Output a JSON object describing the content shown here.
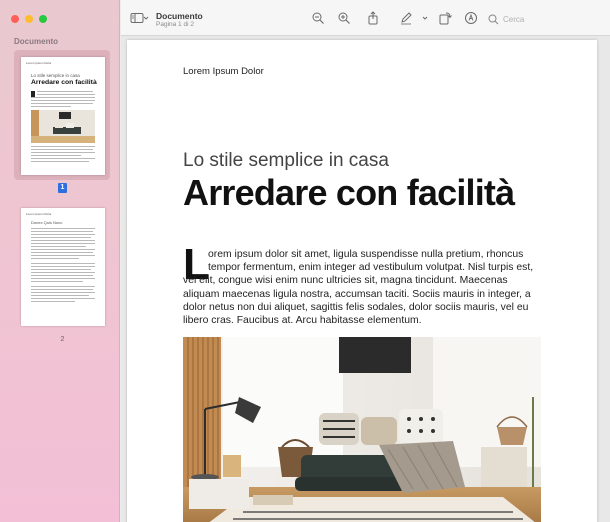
{
  "window": {
    "title": "Documento",
    "subtitle": "Pagina 1 di 2"
  },
  "sidebar": {
    "title": "Documento",
    "pages": [
      {
        "number": "1",
        "selected": true,
        "thumb_header": "Lorem Ipsum Dolor",
        "thumb_subtitle": "Lo stile semplice in casa",
        "thumb_title": "Arredare con facilità"
      },
      {
        "number": "2",
        "selected": false,
        "thumb_header": "Lorem Ipsum Dolor",
        "thumb_subtitle": "Donec Quis Nunc"
      }
    ]
  },
  "toolbar": {
    "icons": [
      "sidebar-toggle-icon",
      "chevron-down-icon",
      "zoom-out-icon",
      "zoom-in-icon",
      "share-icon",
      "markup-pen-icon",
      "chevron-down-icon",
      "rotate-icon",
      "annotate-icon",
      "search-icon"
    ],
    "search_placeholder": "Cerca"
  },
  "document": {
    "header": "Lorem Ipsum Dolor",
    "subtitle": "Lo stile semplice in casa",
    "title": "Arredare con facilità",
    "dropcap": "L",
    "body_lines": [
      "orem ipsum dolor sit amet, ligula suspendisse nulla pretium, rhoncus",
      "tempor fermentum, enim integer ad vestibulum volutpat. Nisl turpis est,",
      "vel elit, congue wisi enim nunc ultricies sit, magna tincidunt. Maecenas",
      "aliquam maecenas ligula nostra, accumsan taciti. Sociis mauris in integer, a",
      "dolor netus non dui aliquet, sagittis felis sodales, dolor sociis mauris, vel eu",
      "libero cras. Faucibus at. Arcu habitasse elementum."
    ]
  },
  "colors": {
    "accent": "#2f6fe0",
    "sidebar_bg": "#f0c4d2"
  }
}
